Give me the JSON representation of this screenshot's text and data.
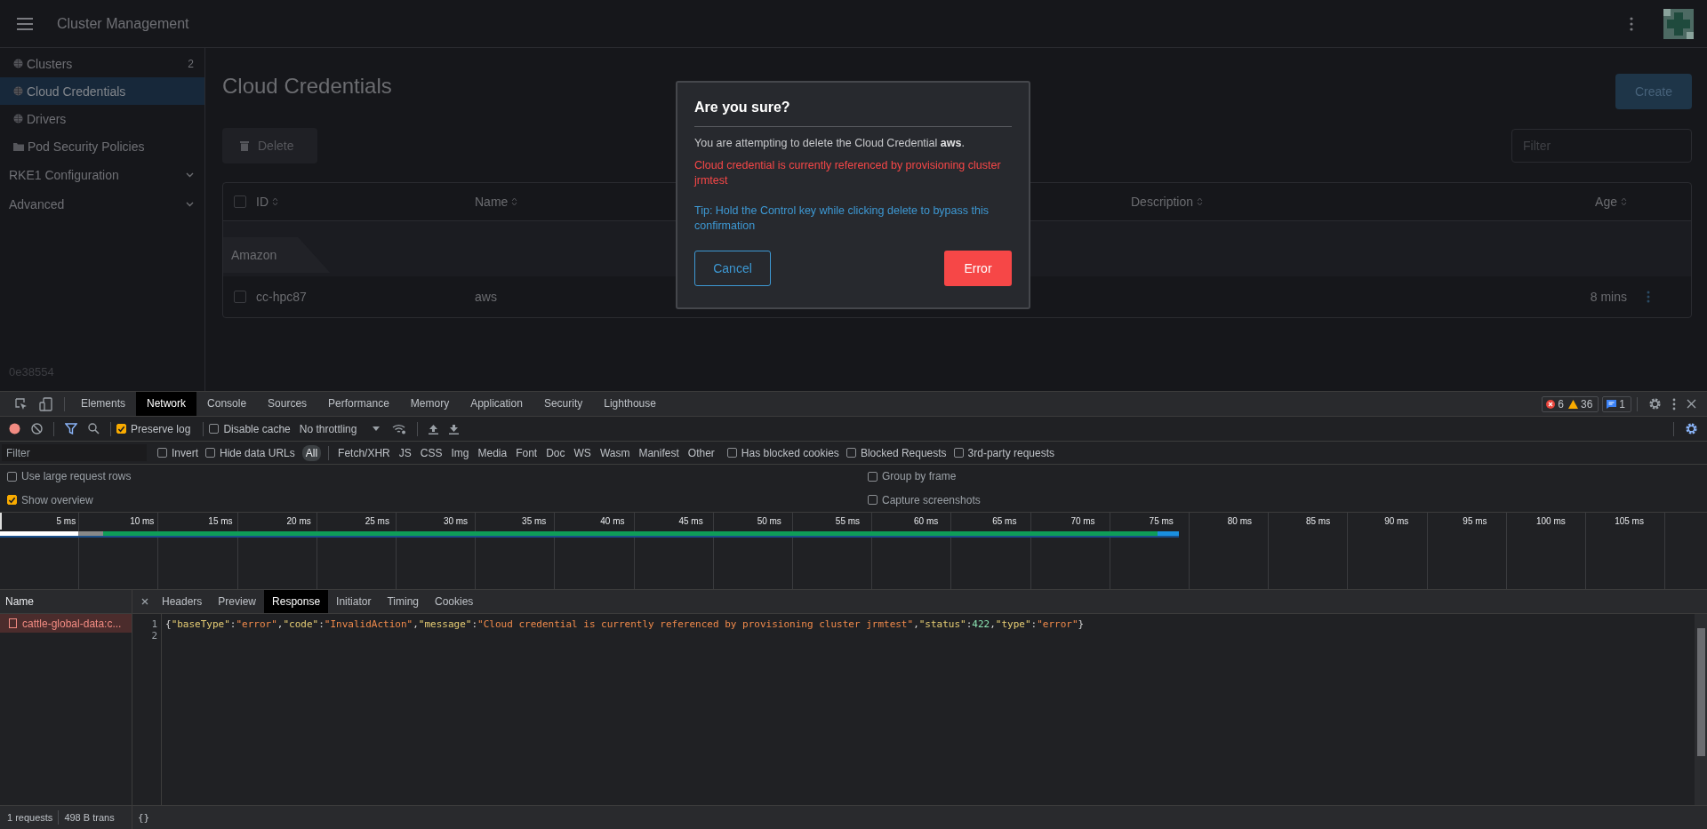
{
  "app": {
    "header": {
      "title": "Cluster Management"
    },
    "sidebar": {
      "items": [
        {
          "kind": "page",
          "label": "Clusters",
          "count": "2",
          "selected": false
        },
        {
          "kind": "page",
          "label": "Cloud Credentials",
          "selected": true
        },
        {
          "kind": "page",
          "label": "Drivers",
          "selected": false
        },
        {
          "kind": "folder",
          "label": "Pod Security Policies",
          "selected": false
        },
        {
          "kind": "section",
          "label": "RKE1 Configuration",
          "expanded": false
        },
        {
          "kind": "section",
          "label": "Advanced",
          "expanded": false
        }
      ],
      "version": "0e38554"
    },
    "page": {
      "title": "Cloud Credentials",
      "delete_button": {
        "label": "Delete",
        "disabled": true
      },
      "create_button": "Create",
      "filter": {
        "placeholder": "Filter"
      },
      "table": {
        "all_checked": false,
        "columns": [
          {
            "label": "ID"
          },
          {
            "label": "Name"
          },
          {
            "label": "Description"
          },
          {
            "label": "Age"
          }
        ],
        "group": "Amazon",
        "rows": [
          {
            "id": "cc-hpc87",
            "name": "aws",
            "description": "",
            "age": "8 mins",
            "checked": false
          }
        ]
      }
    },
    "dialog": {
      "title": "Are you sure?",
      "message": "You are attempting to delete the Cloud Credential **aws**.",
      "error": "Cloud credential is currently referenced by provisioning cluster jrmtest",
      "tip": "Tip: Hold the Control key while clicking delete to bypass this confirmation",
      "cancel": "Cancel",
      "confirm": "Error"
    }
  },
  "devtools": {
    "tabs": [
      {
        "label": "Elements",
        "selected": false
      },
      {
        "label": "Network",
        "selected": true
      },
      {
        "label": "Console",
        "selected": false
      },
      {
        "label": "Sources",
        "selected": false
      },
      {
        "label": "Performance",
        "selected": false
      },
      {
        "label": "Memory",
        "selected": false
      },
      {
        "label": "Application",
        "selected": false
      },
      {
        "label": "Security",
        "selected": false
      },
      {
        "label": "Lighthouse",
        "selected": false
      }
    ],
    "counters": {
      "errors": "6",
      "warnings": "36",
      "messages": "1"
    },
    "toolbar": {
      "preserve_log": {
        "label": "Preserve log",
        "checked": true
      },
      "disable_cache": {
        "label": "Disable cache",
        "checked": false
      },
      "throttling": "No throttling"
    },
    "filter_bar": {
      "placeholder": "Filter",
      "invert": {
        "label": "Invert",
        "checked": false
      },
      "hide_data_urls": {
        "label": "Hide data URLs",
        "checked": false
      },
      "types": [
        {
          "label": "All",
          "selected": true
        },
        {
          "label": "Fetch/XHR",
          "selected": false
        },
        {
          "label": "JS",
          "selected": false
        },
        {
          "label": "CSS",
          "selected": false
        },
        {
          "label": "Img",
          "selected": false
        },
        {
          "label": "Media",
          "selected": false
        },
        {
          "label": "Font",
          "selected": false
        },
        {
          "label": "Doc",
          "selected": false
        },
        {
          "label": "WS",
          "selected": false
        },
        {
          "label": "Wasm",
          "selected": false
        },
        {
          "label": "Manifest",
          "selected": false
        },
        {
          "label": "Other",
          "selected": false
        }
      ],
      "toggles": [
        {
          "label": "Has blocked cookies",
          "checked": false
        },
        {
          "label": "Blocked Requests",
          "checked": false
        },
        {
          "label": "3rd-party requests",
          "checked": false
        }
      ]
    },
    "options": [
      [
        {
          "label": "Use large request rows",
          "checked": false
        },
        {
          "label": "Show overview",
          "checked": true
        }
      ],
      [
        {
          "label": "Group by frame",
          "checked": false
        },
        {
          "label": "Capture screenshots",
          "checked": false
        }
      ]
    ],
    "timeline_ticks": [
      "5 ms",
      "10 ms",
      "15 ms",
      "20 ms",
      "25 ms",
      "30 ms",
      "35 ms",
      "40 ms",
      "45 ms",
      "50 ms",
      "55 ms",
      "60 ms",
      "65 ms",
      "70 ms",
      "75 ms",
      "80 ms",
      "85 ms",
      "90 ms",
      "95 ms",
      "100 ms",
      "105 ms"
    ],
    "requests": {
      "header": "Name",
      "items": [
        {
          "name": "cattle-global-data:c...",
          "failed": true,
          "selected": true
        }
      ]
    },
    "detail_tabs": [
      {
        "label": "Headers",
        "selected": false
      },
      {
        "label": "Preview",
        "selected": false
      },
      {
        "label": "Response",
        "selected": true
      },
      {
        "label": "Initiator",
        "selected": false
      },
      {
        "label": "Timing",
        "selected": false
      },
      {
        "label": "Cookies",
        "selected": false
      }
    ],
    "response": {
      "line_numbers": [
        "1",
        "2"
      ],
      "tokens": [
        {
          "kind": "punct",
          "text": "{"
        },
        {
          "kind": "key",
          "text": "\"baseType\""
        },
        {
          "kind": "punct",
          "text": ":"
        },
        {
          "kind": "string",
          "text": "\"error\""
        },
        {
          "kind": "punct",
          "text": ","
        },
        {
          "kind": "key",
          "text": "\"code\""
        },
        {
          "kind": "punct",
          "text": ":"
        },
        {
          "kind": "string",
          "text": "\"InvalidAction\""
        },
        {
          "kind": "punct",
          "text": ","
        },
        {
          "kind": "key",
          "text": "\"message\""
        },
        {
          "kind": "punct",
          "text": ":"
        },
        {
          "kind": "string",
          "text": "\"Cloud credential is currently referenced by provisioning cluster jrmtest\""
        },
        {
          "kind": "punct",
          "text": ","
        },
        {
          "kind": "key",
          "text": "\"status\""
        },
        {
          "kind": "punct",
          "text": ":"
        },
        {
          "kind": "number",
          "text": "422"
        },
        {
          "kind": "punct",
          "text": ","
        },
        {
          "kind": "key",
          "text": "\"type\""
        },
        {
          "kind": "punct",
          "text": ":"
        },
        {
          "kind": "string",
          "text": "\"error\""
        },
        {
          "kind": "punct",
          "text": "}"
        }
      ]
    },
    "status": {
      "requests": "1 requests",
      "transferred": "498 B trans",
      "pretty_print": "{}"
    }
  }
}
